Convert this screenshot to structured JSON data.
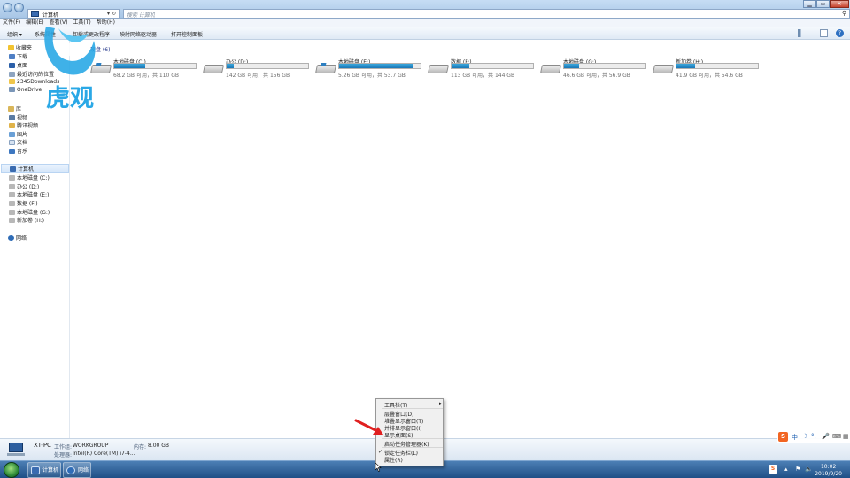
{
  "address": {
    "path": "计算机",
    "dropdown": "▾",
    "refresh": "↻"
  },
  "search": {
    "placeholder": "搜索 计算机",
    "icon": "search-icon"
  },
  "menubar": [
    "文件(F)",
    "编辑(E)",
    "查看(V)",
    "工具(T)",
    "帮助(H)"
  ],
  "toolbar": {
    "organize": "组织 ▾",
    "system_properties": "系统属性",
    "uninstall": "卸载或更改程序",
    "map_network": "映射网络驱动器",
    "control_panel": "打开控制面板"
  },
  "sidebar": {
    "favorites": [
      "收藏夹",
      "下载",
      "桌面",
      "最近访问的位置",
      "2345Downloads",
      "OneDrive"
    ],
    "libraries": [
      "库",
      "视频",
      "腾讯视频",
      "图片",
      "文档",
      "音乐"
    ],
    "computer": [
      "计算机",
      "本地磁盘 (C:)",
      "办公 (D:)",
      "本地磁盘 (E:)",
      "数据 (F:)",
      "本地磁盘 (G:)",
      "新加卷 (H:)"
    ],
    "network": "网络"
  },
  "main": {
    "group_header": "硬盘 (6)"
  },
  "drives": [
    {
      "name": "本地磁盘 (C:)",
      "size": "68.2 GB 可用，共 110 GB",
      "used_fraction": 0.38,
      "system": true
    },
    {
      "name": "办公 (D:)",
      "size": "142 GB 可用，共 156 GB",
      "used_fraction": 0.09,
      "system": false
    },
    {
      "name": "本地磁盘 (E:)",
      "size": "5.26 GB 可用，共 53.7 GB",
      "used_fraction": 0.9,
      "system": true
    },
    {
      "name": "数据 (F:)",
      "size": "113 GB 可用，共 144 GB",
      "used_fraction": 0.22,
      "system": false
    },
    {
      "name": "本地磁盘 (G:)",
      "size": "46.6 GB 可用，共 56.9 GB",
      "used_fraction": 0.18,
      "system": false
    },
    {
      "name": "新加卷 (H:)",
      "size": "41.9 GB 可用，共 54.6 GB",
      "used_fraction": 0.23,
      "system": false
    }
  ],
  "logo": {
    "text": "虎观"
  },
  "details": {
    "pc_name": "XT-PC",
    "workgroup_label": "工作组:",
    "workgroup": "WORKGROUP",
    "memory_label": "内存:",
    "memory": "8.00 GB",
    "cpu_label": "处理器:",
    "cpu": "Intel(R) Core(TM) i7-4..."
  },
  "context_menu": {
    "items": [
      {
        "label": "工具栏(T)",
        "submenu": "▸"
      },
      {
        "label": "层叠窗口(D)"
      },
      {
        "label": "堆叠显示窗口(T)"
      },
      {
        "label": "并排显示窗口(I)"
      },
      {
        "label": "显示桌面(S)"
      },
      {
        "label": "启动任务管理器(K)"
      },
      {
        "label": "锁定任务栏(L)",
        "checked": "✓"
      },
      {
        "label": "属性(R)"
      }
    ]
  },
  "taskbar": {
    "tasks": [
      "计算机",
      "网络"
    ],
    "clock_time": "10:02",
    "clock_date": "2019/9/20"
  },
  "ime": {
    "brand": "S",
    "lang": "中",
    "moon": "☽",
    "punct": "°,",
    "mic": "🎤",
    "keyboard": "⌨"
  },
  "colors": {
    "drive_fill": "#1a78b7",
    "logo_blue": "#2aa8e6"
  }
}
